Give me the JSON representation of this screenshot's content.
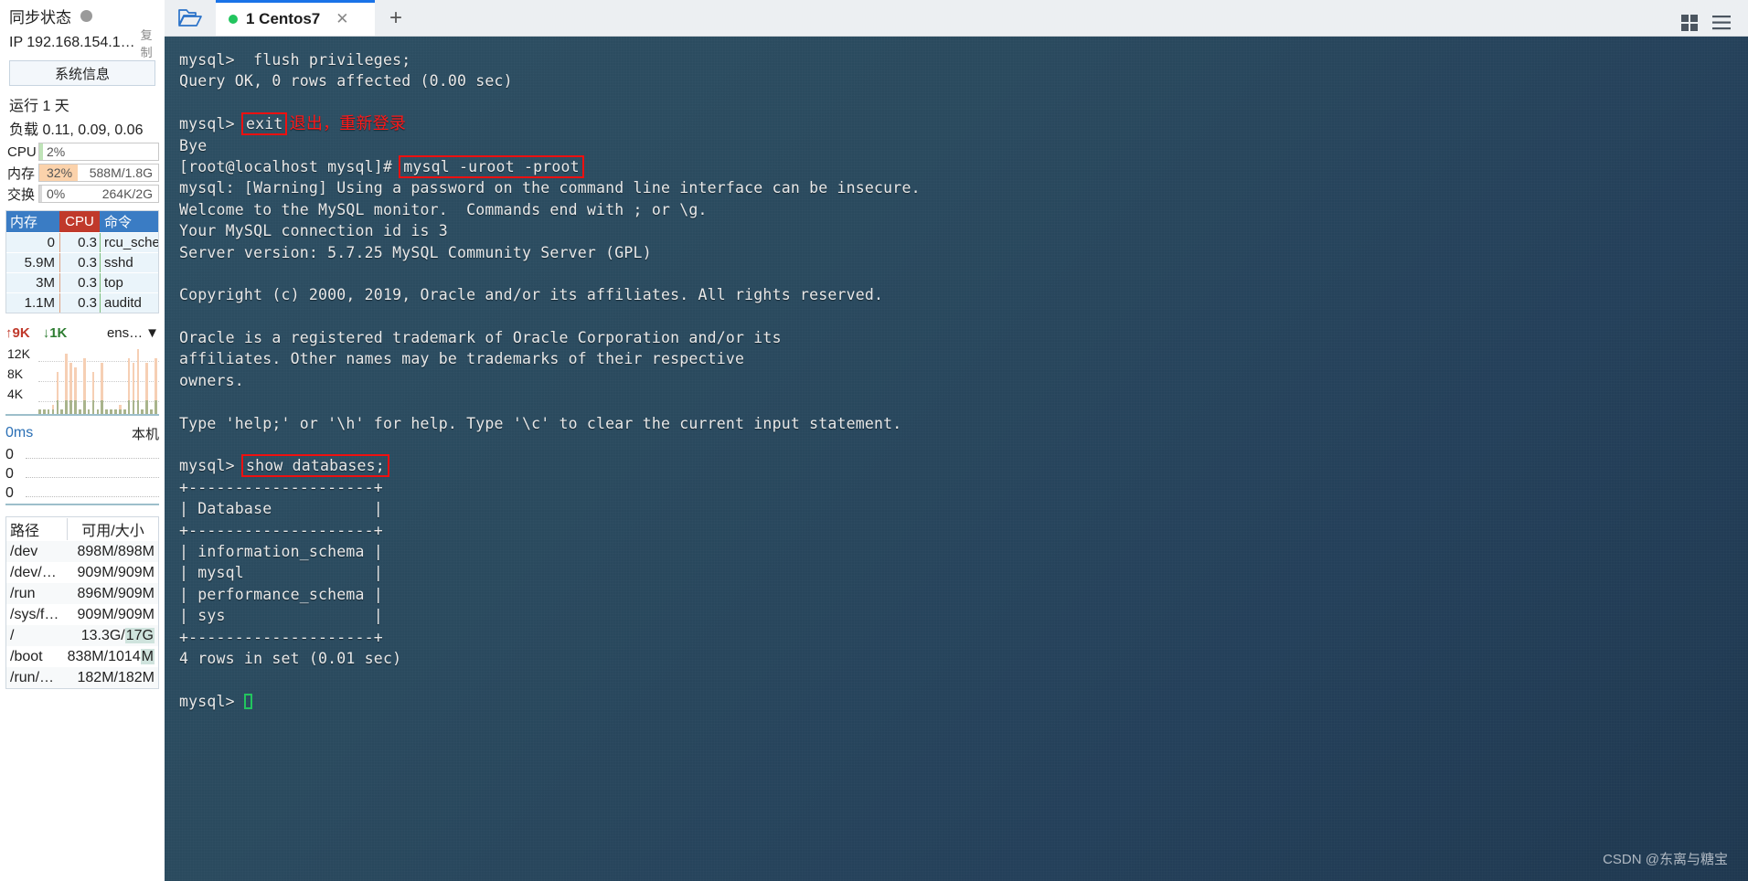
{
  "sidebar": {
    "sync": {
      "label": "同步状态",
      "status_color": "#9a9a9a"
    },
    "ip": {
      "text": "IP 192.168.154.1…",
      "copy_label": "复制"
    },
    "sysinfo_button": "系统信息",
    "uptime": "运行 1 天",
    "loadavg": "负载 0.11, 0.09, 0.06",
    "meters": [
      {
        "label": "CPU",
        "percent": "2%",
        "value": "",
        "fill_color": "#bfe3b8",
        "fill_width": 3
      },
      {
        "label": "内存",
        "percent": "32%",
        "value": "588M/1.8G",
        "fill_color": "#fbd2ab",
        "fill_width": 32
      },
      {
        "label": "交换",
        "percent": "0%",
        "value": "264K/2G",
        "fill_color": "#d8d8d8",
        "fill_width": 0
      }
    ],
    "proc_table": {
      "headers": [
        "内存",
        "CPU",
        "命令"
      ],
      "rows": [
        {
          "mem": "0",
          "cpu": "0.3",
          "cmd": "rcu_sche"
        },
        {
          "mem": "5.9M",
          "cpu": "0.3",
          "cmd": "sshd"
        },
        {
          "mem": "3M",
          "cpu": "0.3",
          "cmd": "top"
        },
        {
          "mem": "1.1M",
          "cpu": "0.3",
          "cmd": "auditd"
        }
      ]
    },
    "network": {
      "up_label": "9K",
      "down_label": "1K",
      "interface": "ens…",
      "y_ticks": [
        "12K",
        "8K",
        "4K"
      ],
      "bars_up": [
        1,
        1,
        1,
        2,
        9,
        1,
        13,
        11,
        10,
        1,
        12,
        1,
        9,
        1,
        11,
        1,
        1,
        1,
        2,
        1,
        12,
        11,
        14,
        1,
        11,
        1,
        12
      ],
      "bars_down": [
        1,
        1,
        1,
        1,
        3,
        1,
        3,
        3,
        3,
        1,
        3,
        1,
        3,
        1,
        3,
        1,
        1,
        1,
        1,
        1,
        3,
        3,
        3,
        1,
        3,
        1,
        3
      ]
    },
    "latency": {
      "value": "0ms",
      "host": "本机",
      "rows": [
        "0",
        "0",
        "0"
      ]
    },
    "disk_table": {
      "headers": [
        "路径",
        "可用/大小"
      ],
      "rows": [
        {
          "path": "/dev",
          "size": "898M/898M",
          "highlight": ""
        },
        {
          "path": "/dev/…",
          "size": "909M/909M",
          "highlight": ""
        },
        {
          "path": "/run",
          "size": "896M/909M",
          "highlight": ""
        },
        {
          "path": "/sys/f…",
          "size": "909M/909M",
          "highlight": ""
        },
        {
          "path": "/",
          "size": "13.3G/",
          "highlight": "17G"
        },
        {
          "path": "/boot",
          "size": "838M/1014",
          "highlight": "M"
        },
        {
          "path": "/run/…",
          "size": "182M/182M",
          "highlight": ""
        }
      ]
    }
  },
  "tabbar": {
    "folder_icon": "folder-open-icon",
    "tab": {
      "label": "1 Centos7",
      "status_color": "#22c55e",
      "close_label": "✕"
    },
    "add_label": "+",
    "grid_icon": "grid-icon",
    "menu_icon": "hamburger-menu-icon"
  },
  "terminal": {
    "watermark": "CSDN @东离与糖宝",
    "annotation": "退出，重新登录",
    "lines": [
      {
        "text": "mysql>  flush privileges;"
      },
      {
        "text": "Query OK, 0 rows affected (0.00 sec)"
      },
      {
        "text": ""
      },
      {
        "text": "mysql> ",
        "box": "exit",
        "annot": " 退出，重新登录"
      },
      {
        "text": "Bye"
      },
      {
        "text": "[root@localhost mysql]# ",
        "box": "mysql -uroot -proot"
      },
      {
        "text": "mysql: [Warning] Using a password on the command line interface can be insecure."
      },
      {
        "text": "Welcome to the MySQL monitor.  Commands end with ; or \\g."
      },
      {
        "text": "Your MySQL connection id is 3"
      },
      {
        "text": "Server version: 5.7.25 MySQL Community Server (GPL)"
      },
      {
        "text": ""
      },
      {
        "text": "Copyright (c) 2000, 2019, Oracle and/or its affiliates. All rights reserved."
      },
      {
        "text": ""
      },
      {
        "text": "Oracle is a registered trademark of Oracle Corporation and/or its"
      },
      {
        "text": "affiliates. Other names may be trademarks of their respective"
      },
      {
        "text": "owners."
      },
      {
        "text": ""
      },
      {
        "text": "Type 'help;' or '\\h' for help. Type '\\c' to clear the current input statement."
      },
      {
        "text": ""
      },
      {
        "text": "mysql> ",
        "box": "show databases;"
      },
      {
        "text": "+--------------------+"
      },
      {
        "text": "| Database           |"
      },
      {
        "text": "+--------------------+"
      },
      {
        "text": "| information_schema |"
      },
      {
        "text": "| mysql              |"
      },
      {
        "text": "| performance_schema |"
      },
      {
        "text": "| sys                |"
      },
      {
        "text": "+--------------------+"
      },
      {
        "text": "4 rows in set (0.01 sec)"
      },
      {
        "text": ""
      },
      {
        "text": "mysql> ",
        "cursor": true
      }
    ]
  }
}
